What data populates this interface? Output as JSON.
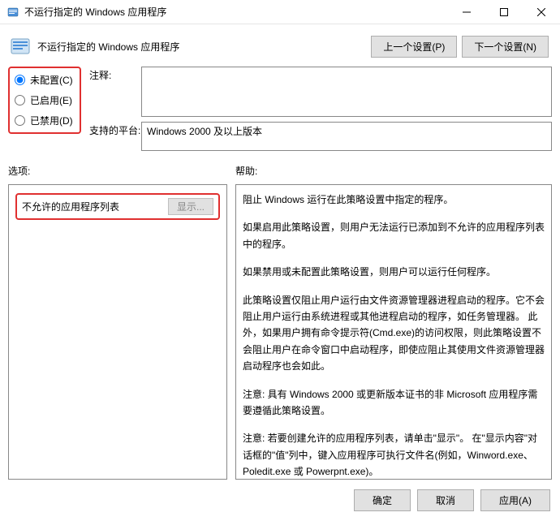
{
  "window": {
    "title": "不运行指定的 Windows 应用程序"
  },
  "header": {
    "title": "不运行指定的 Windows 应用程序",
    "prev_button": "上一个设置(P)",
    "next_button": "下一个设置(N)"
  },
  "config": {
    "not_configured": "未配置(C)",
    "enabled": "已启用(E)",
    "disabled": "已禁用(D)",
    "comment_label": "注释:",
    "comment_value": "",
    "platform_label": "支持的平台:",
    "platform_value": "Windows 2000 及以上版本"
  },
  "labels": {
    "options": "选项:",
    "help": "帮助:"
  },
  "options": {
    "disallowed_list": "不允许的应用程序列表",
    "show_button": "显示..."
  },
  "help": {
    "p1": "阻止 Windows 运行在此策略设置中指定的程序。",
    "p2": "如果启用此策略设置，则用户无法运行已添加到不允许的应用程序列表中的程序。",
    "p3": "如果禁用或未配置此策略设置，则用户可以运行任何程序。",
    "p4": "此策略设置仅阻止用户运行由文件资源管理器进程启动的程序。它不会阻止用户运行由系统进程或其他进程启动的程序，如任务管理器。 此外，如果用户拥有命令提示符(Cmd.exe)的访问权限，则此策略设置不会阻止用户在命令窗口中启动程序，即使应阻止其使用文件资源管理器启动程序也会如此。",
    "p5": "注意: 具有 Windows 2000 或更新版本证书的非 Microsoft 应用程序需要遵循此策略设置。",
    "p6": "注意: 若要创建允许的应用程序列表，请单击\"显示\"。  在\"显示内容\"对话框的\"值\"列中，键入应用程序可执行文件名(例如，Winword.exe、Poledit.exe 或 Powerpnt.exe)。"
  },
  "footer": {
    "ok": "确定",
    "cancel": "取消",
    "apply": "应用(A)"
  }
}
